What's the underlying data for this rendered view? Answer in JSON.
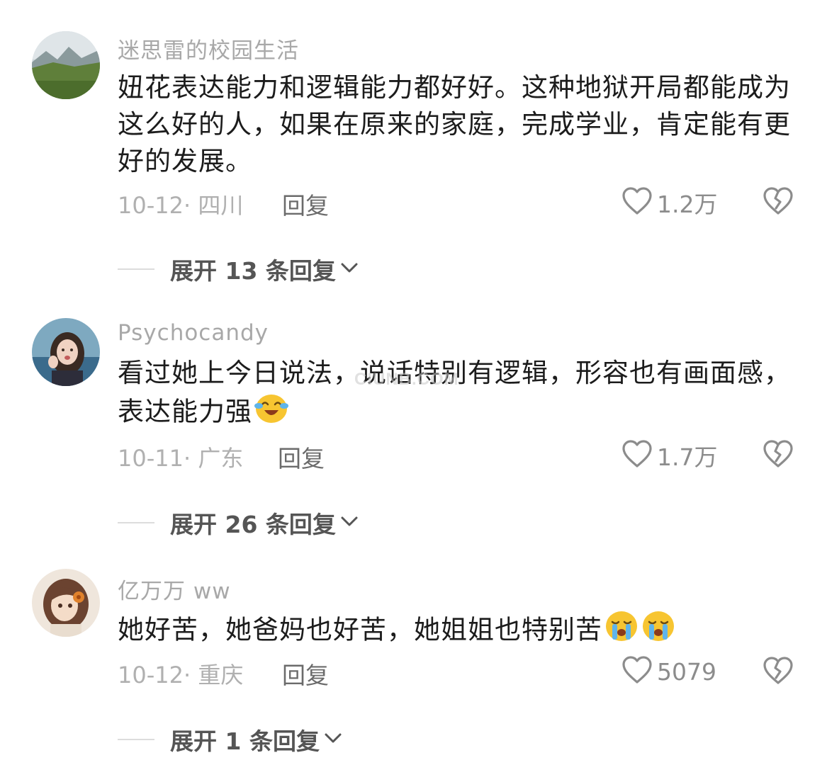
{
  "comments": [
    {
      "username": "迷思雷的校园生活",
      "text": "妞花表达能力和逻辑能力都好好。这种地狱开局都能成为这么好的人，如果在原来的家庭，完成学业，肯定能有更好的发展。",
      "date_location": "10-12· 四川",
      "reply_label": "回复",
      "likes": "1.2万",
      "expand_label": "展开 13 条回复",
      "avatar": "landscape-photo"
    },
    {
      "username": "Psychocandy",
      "text": "看过她上今日说法，说话特别有逻辑，形容也有画面感，表达能力强",
      "emojis": [
        "laughing-crying-emoji"
      ],
      "date_location": "10-11· 广东",
      "reply_label": "回复",
      "likes": "1.7万",
      "expand_label": "展开 26 条回复",
      "avatar": "girl-photo"
    },
    {
      "username": "亿万万 ww",
      "text": "她好苦，她爸妈也好苦，她姐姐也特别苦",
      "emojis": [
        "crying-emoji",
        "crying-emoji"
      ],
      "date_location": "10-12· 重庆",
      "reply_label": "回复",
      "likes": "5079",
      "expand_label": "展开 1 条回复",
      "avatar": "anime-girl-drawing"
    }
  ],
  "watermark": "CIUNB.COM",
  "colors": {
    "username": "#a8a8a8",
    "body_text": "#1c1c1c",
    "meta": "#b0b0b0",
    "reply": "#6b6b6b",
    "expand": "#555555"
  }
}
